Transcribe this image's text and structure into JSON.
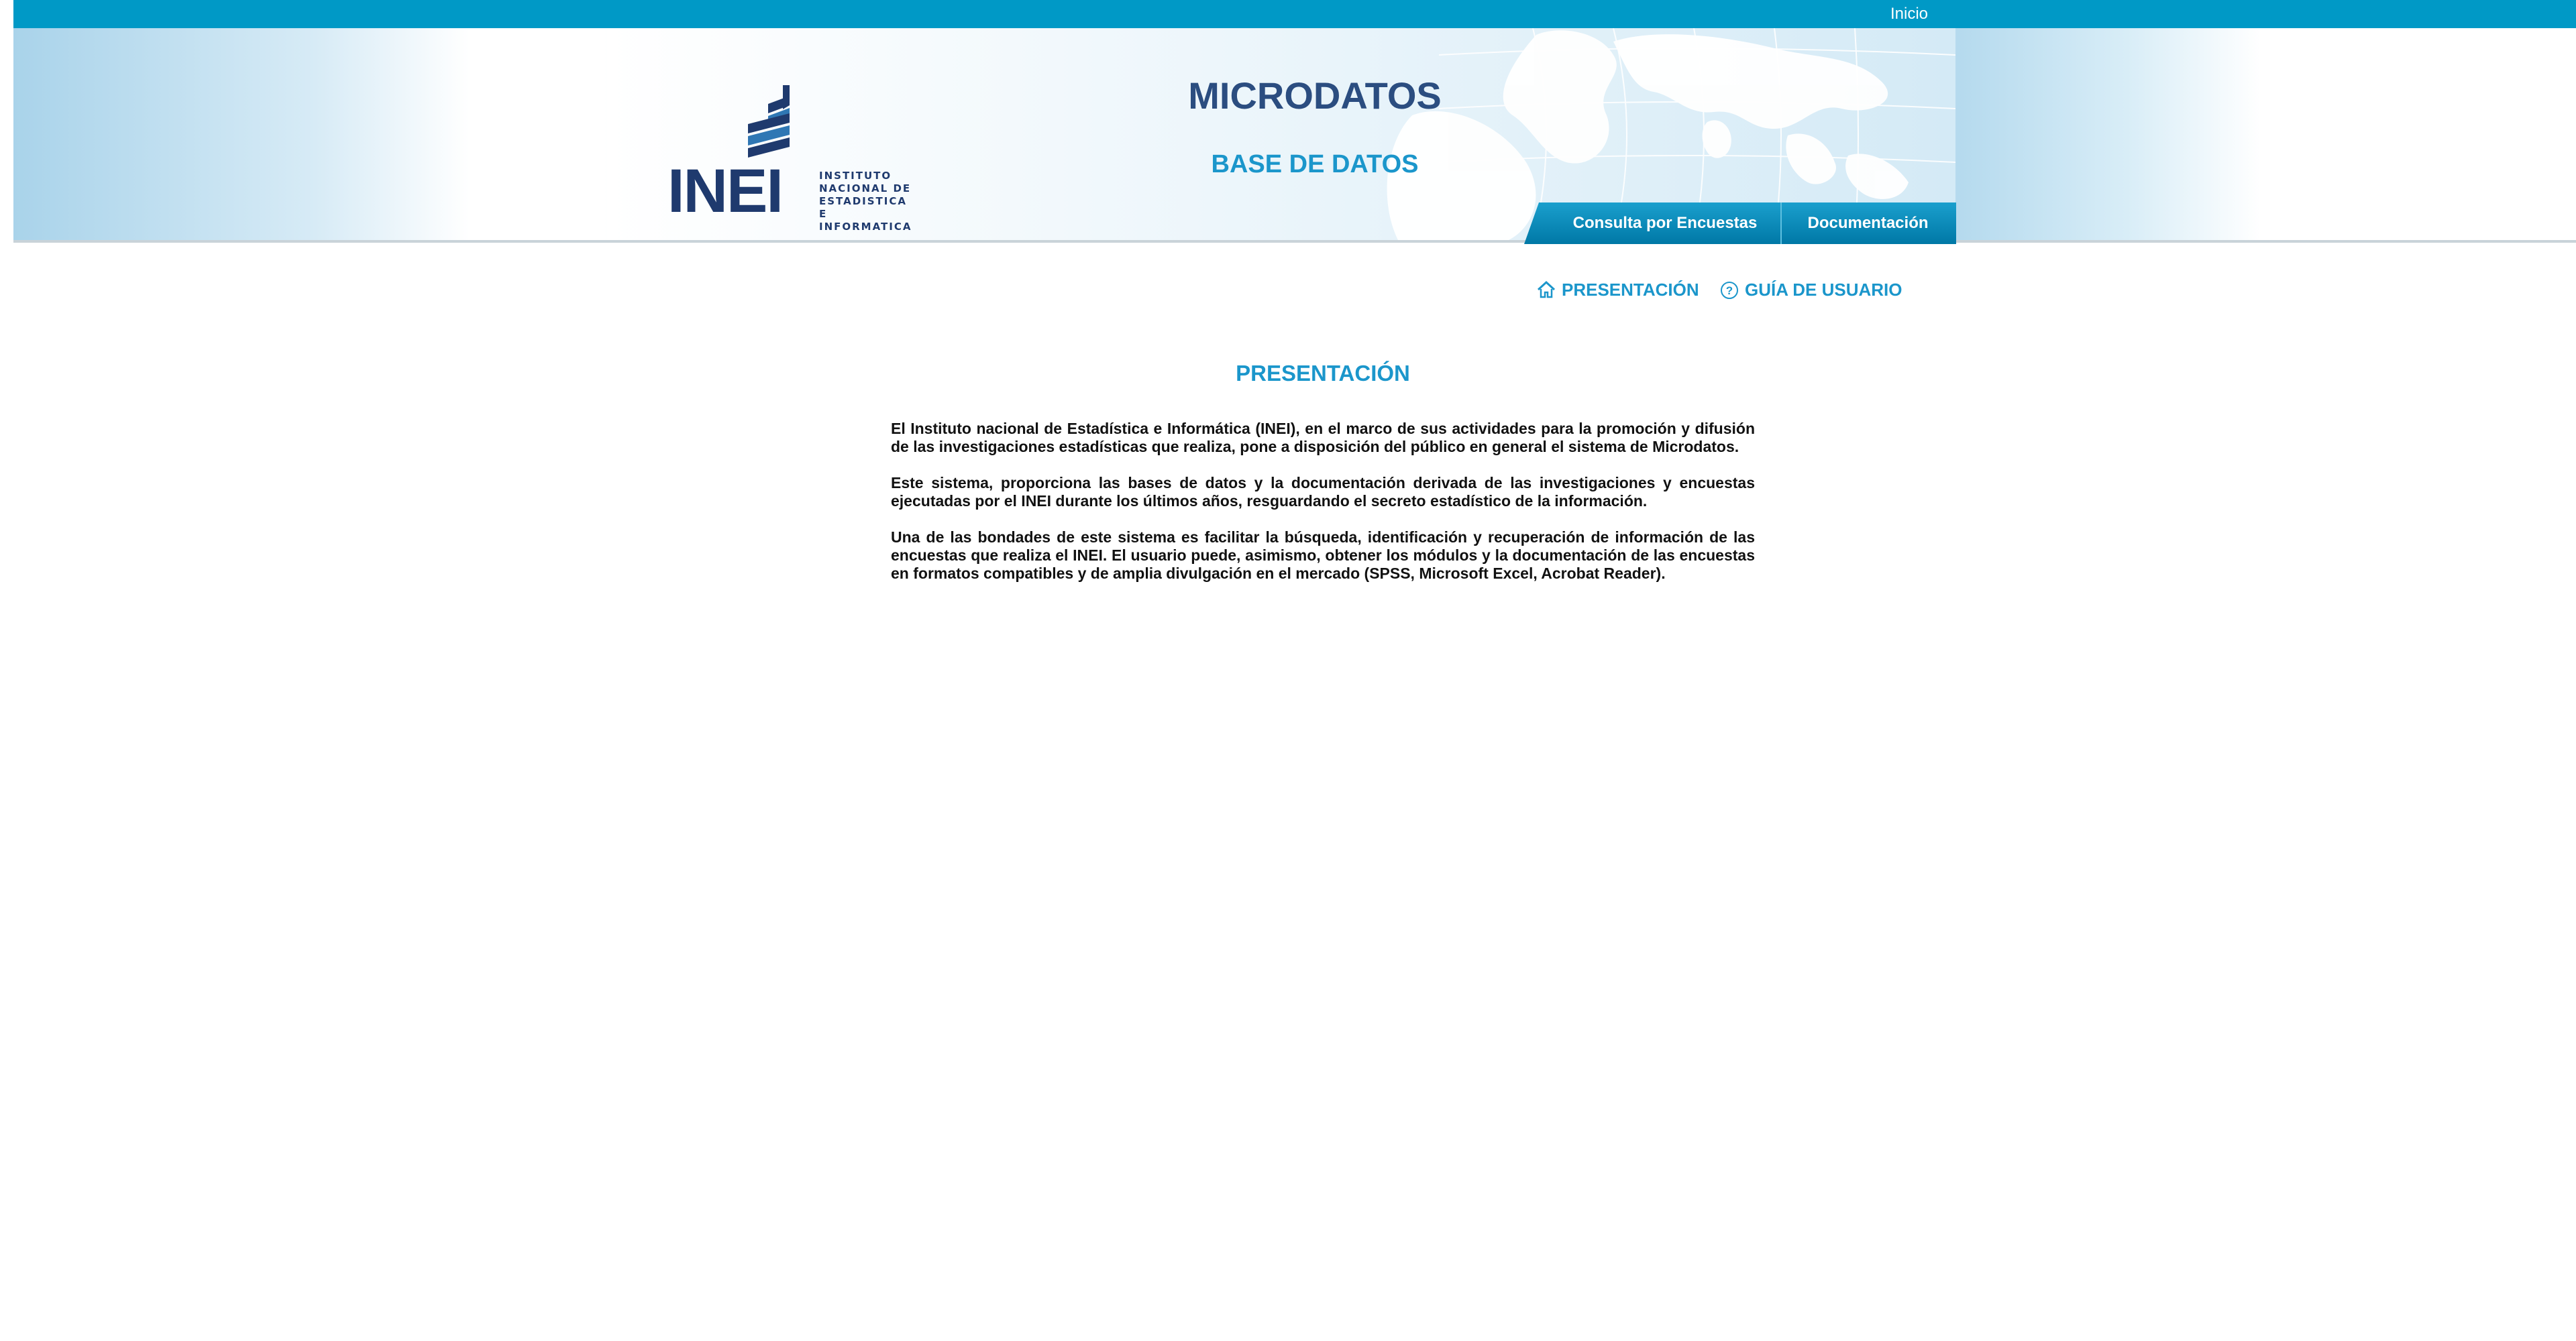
{
  "topbar": {
    "inicio_label": "Inicio"
  },
  "logo": {
    "text": "INEI",
    "subtitle_lines": [
      "INSTITUTO",
      "NACIONAL DE",
      "ESTADISTICA E",
      "INFORMATICA"
    ]
  },
  "banner": {
    "title": "MICRODATOS",
    "subtitle": "BASE DE DATOS"
  },
  "tabs": [
    {
      "label": "Consulta por Encuestas"
    },
    {
      "label": "Documentación"
    }
  ],
  "subnav": {
    "presentacion_label": "PRESENTACIÓN",
    "guia_label": "GUÍA DE USUARIO"
  },
  "main": {
    "heading": "PRESENTACIÓN",
    "paragraphs": [
      "El Instituto nacional de Estadística e Informática (INEI), en el marco de sus actividades para la promoción y difusión de las investigaciones estadísticas que realiza, pone a disposición del público en general el sistema de Microdatos.",
      "Este sistema, proporciona las bases de datos y la documentación derivada de las investigaciones y encuestas ejecutadas por el INEI durante los últimos años, resguardando el secreto estadístico de la información.",
      "Una de las bondades de este sistema es facilitar la búsqueda, identificación y recuperación de información de las encuestas que realiza el INEI. El usuario puede, asimismo, obtener los módulos y la documentación de las encuestas en formatos compatibles y de amplia divulgación en el mercado (SPSS, Microsoft Excel, Acrobat Reader)."
    ]
  },
  "colors": {
    "topbar": "#0099c6",
    "accent": "#1b96cb",
    "brand_dark": "#1f3a6e",
    "tab": "#0086b3"
  },
  "icons": {
    "presentacion": "home-icon",
    "guia": "help-circle-icon"
  }
}
